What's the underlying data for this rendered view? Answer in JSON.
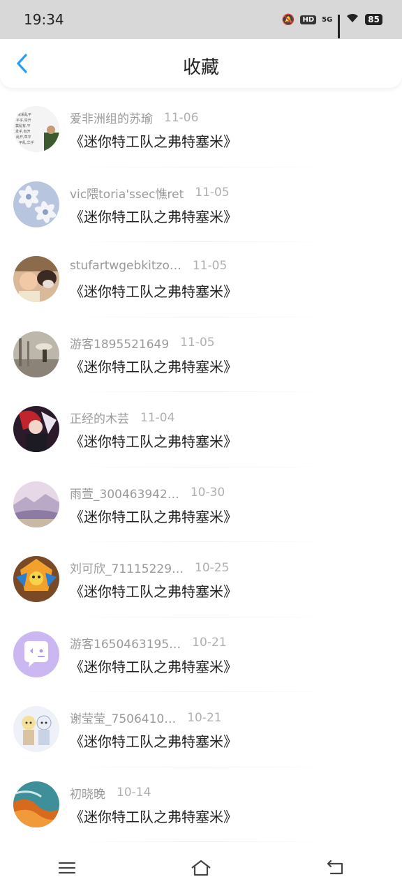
{
  "status": {
    "time": "19:34",
    "battery": "85",
    "network": "5G",
    "hd": "HD"
  },
  "header": {
    "title": "收藏"
  },
  "items": [
    {
      "user": "爱非洲组的苏瑜",
      "date": "11-06",
      "title": "《迷你特工队之弗特塞米》",
      "avatar": "text-collage"
    },
    {
      "user": "vic隈toria'ssec憔ret",
      "date": "11-05",
      "title": "《迷你特工队之弗特塞米》",
      "avatar": "daisy"
    },
    {
      "user": "stufartwgebkitzo…",
      "date": "11-05",
      "title": "《迷你特工队之弗特塞米》",
      "avatar": "child-dog"
    },
    {
      "user": "游客1895521649",
      "date": "11-05",
      "title": "《迷你特工队之弗特塞米》",
      "avatar": "street"
    },
    {
      "user": "正经的木芸",
      "date": "11-04",
      "title": "《迷你特工队之弗特塞米》",
      "avatar": "anime-red"
    },
    {
      "user": "雨萱_300463942…",
      "date": "10-30",
      "title": "《迷你特工队之弗特塞米》",
      "avatar": "landscape"
    },
    {
      "user": "刘可欣_71115229…",
      "date": "10-25",
      "title": "《迷你特工队之弗特塞米》",
      "avatar": "cartoon-fire"
    },
    {
      "user": "游客1650463195…",
      "date": "10-21",
      "title": "《迷你特工队之弗特塞米》",
      "avatar": "chat-bubble"
    },
    {
      "user": "谢莹莹_7506410…",
      "date": "10-21",
      "title": "《迷你特工队之弗特塞米》",
      "avatar": "anime-pair"
    },
    {
      "user": "初晓晚",
      "date": "10-14",
      "title": "《迷你特工队之弗特塞米》",
      "avatar": "coast"
    }
  ]
}
